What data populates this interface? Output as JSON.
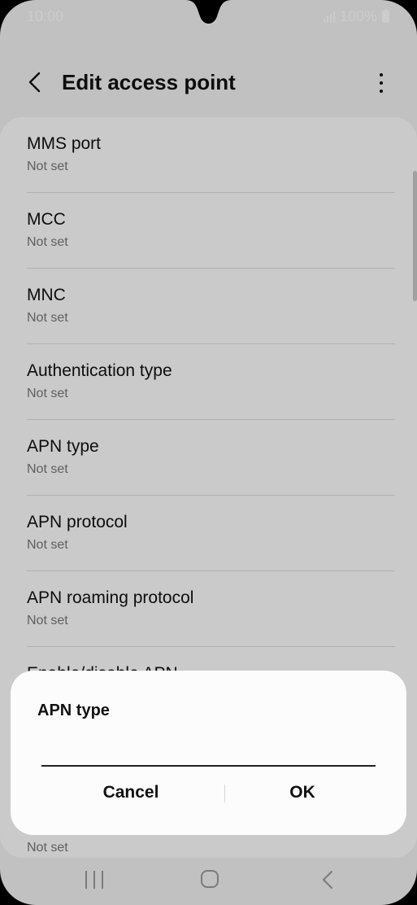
{
  "status_bar": {
    "time": "10:00",
    "battery": "100%"
  },
  "header": {
    "title": "Edit access point",
    "back_icon": "back-arrow-icon",
    "more_icon": "more-vertical-icon"
  },
  "settings": [
    {
      "title": "MMS port",
      "value": "Not set"
    },
    {
      "title": "MCC",
      "value": "Not set"
    },
    {
      "title": "MNC",
      "value": "Not set"
    },
    {
      "title": "Authentication type",
      "value": "Not set"
    },
    {
      "title": "APN type",
      "value": "Not set"
    },
    {
      "title": "APN protocol",
      "value": "Not set"
    },
    {
      "title": "APN roaming protocol",
      "value": "Not set"
    },
    {
      "title": "Enable/disable APN",
      "value": ""
    },
    {
      "title": "",
      "value": "Not set"
    }
  ],
  "dialog": {
    "title": "APN type",
    "input_value": "",
    "cancel_label": "Cancel",
    "ok_label": "OK"
  },
  "nav_bar": {
    "recent_icon": "recent-apps-icon",
    "home_icon": "home-icon",
    "back_icon": "nav-back-icon"
  },
  "colors": {
    "background": "#f2f2f2",
    "card": "#fdfdfd",
    "dialog": "#fcfcfc",
    "text": "#111111",
    "subtext": "#777777"
  }
}
